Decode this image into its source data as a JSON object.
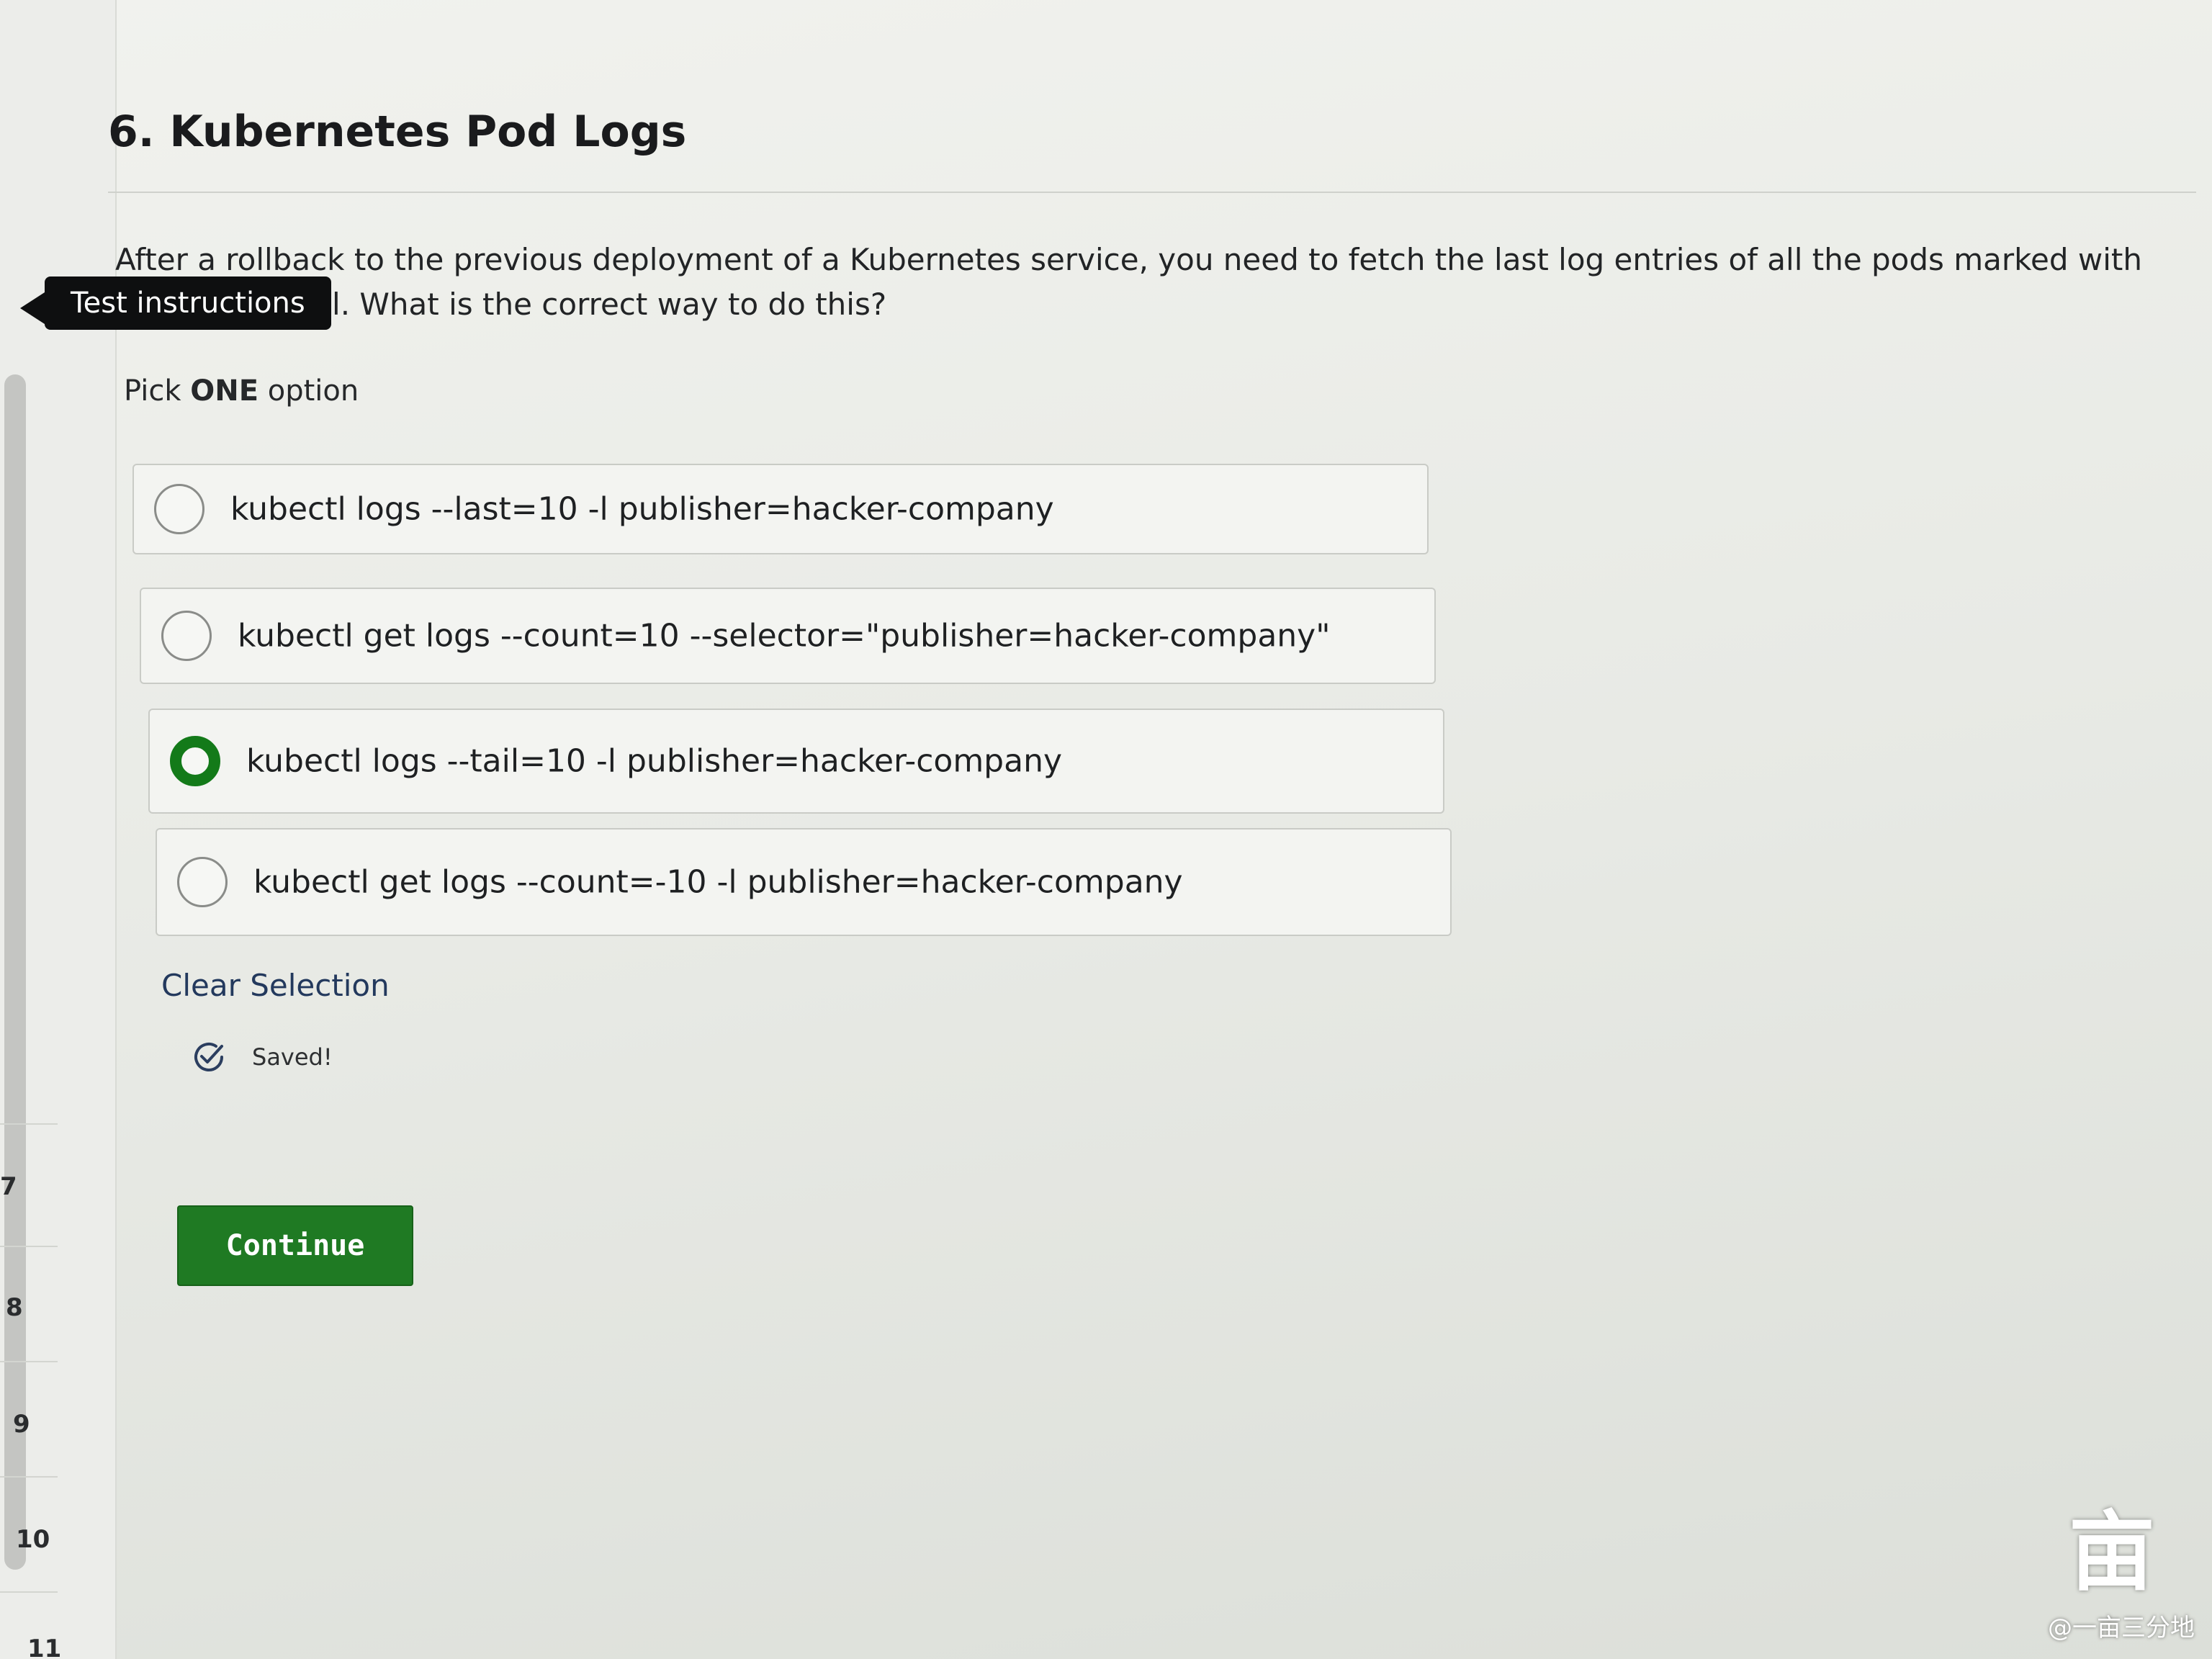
{
  "question": {
    "title": "6. Kubernetes Pod Logs",
    "text": "After a rollback to the previous deployment of a Kubernetes service, you need to fetch the last log entries of all the pods marked with a specific label. What is the correct way to do this?",
    "instruction_prefix": "Pick ",
    "instruction_strong": "ONE",
    "instruction_suffix": " option"
  },
  "tooltip": {
    "label": "Test instructions"
  },
  "options": [
    {
      "text": "kubectl logs --last=10 -l publisher=hacker-company",
      "selected": false
    },
    {
      "text": "kubectl get logs --count=10 --selector=\"publisher=hacker-company\"",
      "selected": false
    },
    {
      "text": "kubectl logs --tail=10 -l publisher=hacker-company",
      "selected": true
    },
    {
      "text": "kubectl get logs --count=-10 -l publisher=hacker-company",
      "selected": false
    }
  ],
  "actions": {
    "clear_label": "Clear Selection",
    "saved_label": "Saved!",
    "continue_label": "Continue"
  },
  "sidebar": {
    "question_numbers": [
      "7",
      "8",
      "9",
      "10",
      "11"
    ]
  },
  "watermark": {
    "text": "@一亩三分地"
  },
  "colors": {
    "accent_green": "#137a19",
    "button_green": "#1f7a23",
    "link_blue": "#23395d",
    "tooltip_bg": "#0e0f10"
  }
}
